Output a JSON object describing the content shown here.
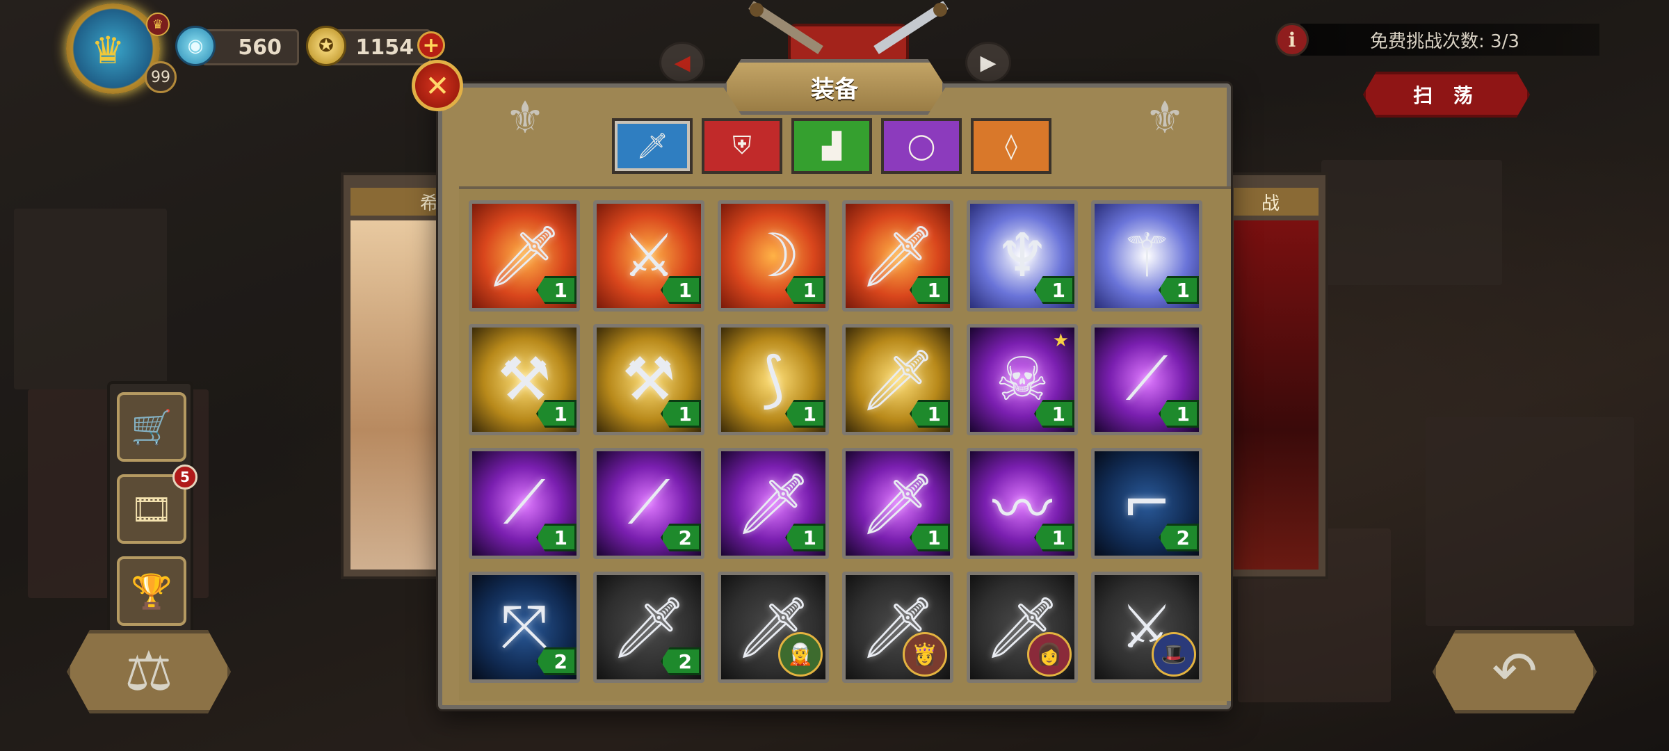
{
  "hud": {
    "player_level": "99",
    "gems": "560",
    "medals": "1154",
    "plus_label": "+"
  },
  "top": {
    "free_challenges": "免费挑战次数: 3/3",
    "sweep_label": "扫 荡",
    "info_icon": "i"
  },
  "side_cards": {
    "left_title": "希",
    "right_title": "战"
  },
  "left_rail": {
    "video_badge": "5"
  },
  "modal": {
    "title": "装备",
    "close_label": "✕",
    "tabs": [
      {
        "name": "tab-weapon",
        "icon": "sword-icon",
        "glyph": "🗡",
        "color": "#2f7ec1"
      },
      {
        "name": "tab-armor",
        "icon": "shield-icon",
        "glyph": "⛨",
        "color": "#c12a2a"
      },
      {
        "name": "tab-boots",
        "icon": "boot-icon",
        "glyph": "▟",
        "color": "#35a02f"
      },
      {
        "name": "tab-ring",
        "icon": "ring-icon",
        "glyph": "◯",
        "color": "#8c3bbd"
      },
      {
        "name": "tab-amulet",
        "icon": "amulet-icon",
        "glyph": "◊",
        "color": "#d9782a"
      }
    ],
    "items": [
      {
        "icon": "lightning-dagger-icon",
        "glyph": "🗡",
        "bg": "red",
        "qty": "1"
      },
      {
        "icon": "flame-sword-icon",
        "glyph": "⚔",
        "bg": "red",
        "qty": "1"
      },
      {
        "icon": "curved-blade-icon",
        "glyph": "☽",
        "bg": "red",
        "qty": "1"
      },
      {
        "icon": "dark-dagger-icon",
        "glyph": "🗡",
        "bg": "red",
        "qty": "1"
      },
      {
        "icon": "golden-trident-icon",
        "glyph": "♆",
        "bg": "blue",
        "qty": "1"
      },
      {
        "icon": "golden-scepter-icon",
        "glyph": "⚚",
        "bg": "blue",
        "qty": "1"
      },
      {
        "icon": "war-hammer-icon",
        "glyph": "⚒",
        "bg": "gold",
        "qty": "1"
      },
      {
        "icon": "double-axe-icon",
        "glyph": "⚒",
        "bg": "gold",
        "qty": "1"
      },
      {
        "icon": "serrated-blade-icon",
        "glyph": "⟆",
        "bg": "gold",
        "qty": "1"
      },
      {
        "icon": "longsword-icon",
        "glyph": "🗡",
        "bg": "gold",
        "qty": "1"
      },
      {
        "icon": "skull-axe-icon",
        "glyph": "☠",
        "bg": "purple",
        "qty": "1",
        "star": "★"
      },
      {
        "icon": "crystal-spear-icon",
        "glyph": "⟋",
        "bg": "purple",
        "qty": "1"
      },
      {
        "icon": "crystal-spear-icon",
        "glyph": "⟋",
        "bg": "purple",
        "qty": "1"
      },
      {
        "icon": "crystal-spear-icon",
        "glyph": "⟋",
        "bg": "purple",
        "qty": "2"
      },
      {
        "icon": "short-sword-icon",
        "glyph": "🗡",
        "bg": "purple",
        "qty": "1"
      },
      {
        "icon": "short-sword-icon",
        "glyph": "🗡",
        "bg": "purple",
        "qty": "1"
      },
      {
        "icon": "wavy-blade-icon",
        "glyph": "〰",
        "bg": "purple",
        "qty": "1"
      },
      {
        "icon": "flintlock-pistol-icon",
        "glyph": "⌐",
        "bg": "navy",
        "qty": "2"
      },
      {
        "icon": "crossbow-icon",
        "glyph": "⤧",
        "bg": "navy",
        "qty": "2"
      },
      {
        "icon": "steel-sword-icon",
        "glyph": "🗡",
        "bg": "dark",
        "qty": "2"
      },
      {
        "icon": "steel-sword-icon",
        "glyph": "🗡",
        "bg": "dark",
        "portrait": "ranger-portrait-icon",
        "face": "🧝",
        "ring": "#3d6b2e"
      },
      {
        "icon": "steel-sword-icon",
        "glyph": "🗡",
        "bg": "dark",
        "portrait": "valkyrie-portrait-icon",
        "face": "👸",
        "ring": "#7a3b2e"
      },
      {
        "icon": "steel-sword-icon",
        "glyph": "🗡",
        "bg": "dark",
        "portrait": "sorceress-portrait-icon",
        "face": "👩",
        "ring": "#8a2a3a"
      },
      {
        "icon": "sabre-icon",
        "glyph": "⚔",
        "bg": "dark",
        "portrait": "officer-portrait-icon",
        "face": "🎩",
        "ring": "#2a3a7a"
      }
    ]
  },
  "colors": {
    "bg_red": "#d9461c",
    "bg_blue": "#6a74d9",
    "bg_gold": "#b8891a",
    "bg_purple": "#7a1fb0",
    "bg_navy": "#102a52",
    "bg_dark": "#2e2e2e",
    "qty_green": "#1e8a2c"
  }
}
